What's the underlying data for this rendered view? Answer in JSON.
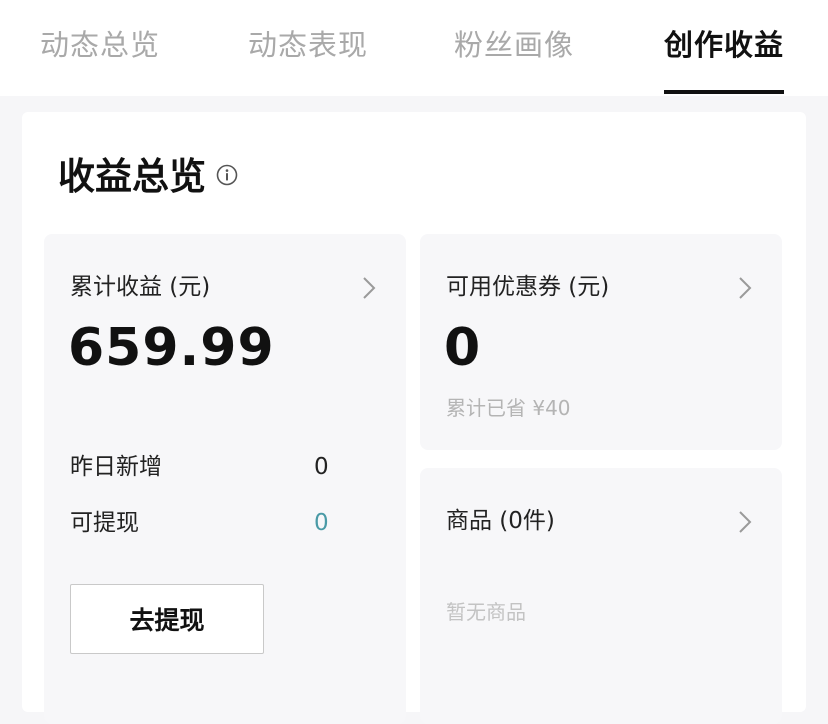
{
  "tabs": [
    {
      "label": "动态总览",
      "active": false
    },
    {
      "label": "动态表现",
      "active": false
    },
    {
      "label": "粉丝画像",
      "active": false
    },
    {
      "label": "创作收益",
      "active": true
    }
  ],
  "overview": {
    "title": "收益总览"
  },
  "earnings_card": {
    "label": "累计收益 (元)",
    "amount": "659.99",
    "yesterday_label": "昨日新增",
    "yesterday_value": "0",
    "withdrawable_label": "可提现",
    "withdrawable_value": "0",
    "withdraw_button": "去提现"
  },
  "coupon_card": {
    "label": "可用优惠券 (元)",
    "amount": "0",
    "saved_text": "累计已省 ¥40"
  },
  "goods_card": {
    "label": "商品 (0件)",
    "empty_text": "暂无商品"
  },
  "colors": {
    "accent_teal": "#4a9aa6",
    "active_tab": "#111111",
    "inactive_tab": "#a9a9a9"
  }
}
